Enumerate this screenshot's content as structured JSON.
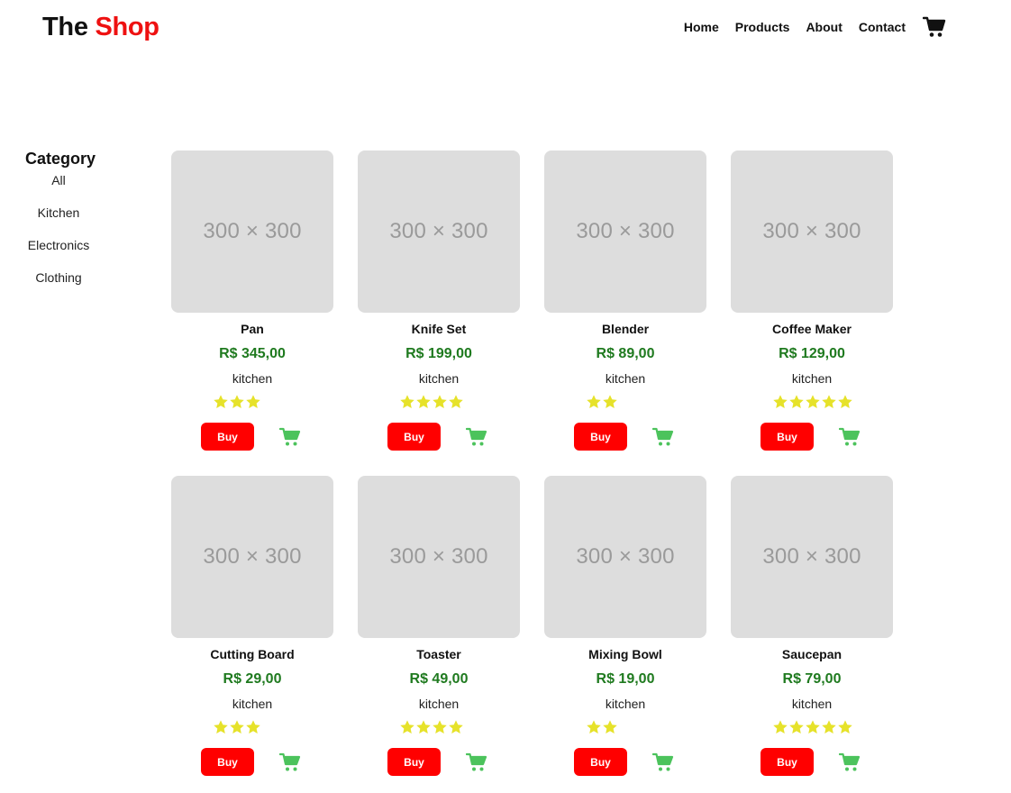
{
  "header": {
    "logo_part1": "The",
    "logo_part2": "Shop",
    "nav": [
      "Home",
      "Products",
      "About",
      "Contact"
    ],
    "cart_icon": "shopping-cart-icon"
  },
  "sidebar": {
    "title": "Category",
    "items": [
      "All",
      "Kitchen",
      "Electronics",
      "Clothing"
    ]
  },
  "colors": {
    "brand_red": "#ee1111",
    "price_green": "#1f7a1f",
    "buy_button": "#ff0000",
    "cart_green": "#4cc35c",
    "star_yellow": "#e6e22a",
    "placeholder_bg": "#dddddd"
  },
  "buy_label": "Buy",
  "products": [
    {
      "image_text": "300 × 300",
      "name": "Pan",
      "price": "R$ 345,00",
      "category": "kitchen",
      "rating": 3
    },
    {
      "image_text": "300 × 300",
      "name": "Knife Set",
      "price": "R$ 199,00",
      "category": "kitchen",
      "rating": 4
    },
    {
      "image_text": "300 × 300",
      "name": "Blender",
      "price": "R$ 89,00",
      "category": "kitchen",
      "rating": 2
    },
    {
      "image_text": "300 × 300",
      "name": "Coffee Maker",
      "price": "R$ 129,00",
      "category": "kitchen",
      "rating": 5
    },
    {
      "image_text": "300 × 300",
      "name": "Cutting Board",
      "price": "R$ 29,00",
      "category": "kitchen",
      "rating": 3
    },
    {
      "image_text": "300 × 300",
      "name": "Toaster",
      "price": "R$ 49,00",
      "category": "kitchen",
      "rating": 4
    },
    {
      "image_text": "300 × 300",
      "name": "Mixing Bowl",
      "price": "R$ 19,00",
      "category": "kitchen",
      "rating": 2
    },
    {
      "image_text": "300 × 300",
      "name": "Saucepan",
      "price": "R$ 79,00",
      "category": "kitchen",
      "rating": 5
    }
  ]
}
